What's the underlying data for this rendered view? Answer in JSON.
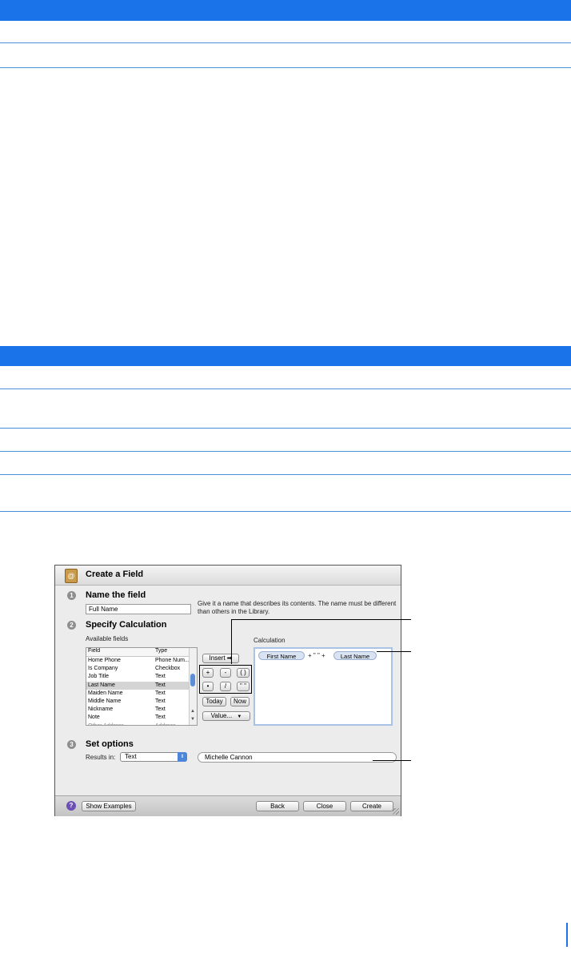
{
  "window": {
    "title": "Create a Field",
    "app_icon": "address-book-icon",
    "steps": {
      "step1": {
        "number": "1",
        "heading": "Name the field"
      },
      "step2": {
        "number": "2",
        "heading": "Specify Calculation"
      },
      "step3": {
        "number": "3",
        "heading": "Set options"
      }
    },
    "name_field_value": "Full Name",
    "name_hint": "Give it a name that describes its contents. The name must be different than others in the Library.",
    "available_fields_label": "Available fields",
    "columns": {
      "field": "Field",
      "type": "Type"
    },
    "rows": [
      {
        "field": "Home Phone",
        "type": "Phone Num..."
      },
      {
        "field": "Is Company",
        "type": "Checkbox"
      },
      {
        "field": "Job Title",
        "type": "Text"
      },
      {
        "field": "Last Name",
        "type": "Text"
      },
      {
        "field": "Maiden Name",
        "type": "Text"
      },
      {
        "field": "Middle Name",
        "type": "Text"
      },
      {
        "field": "Nickname",
        "type": "Text"
      },
      {
        "field": "Note",
        "type": "Text"
      },
      {
        "field": "Other Address",
        "type": "Address"
      }
    ],
    "selected_row": "Last Name",
    "insert_button": "Insert ➡",
    "operators": {
      "plus": "+",
      "minus": "-",
      "parens": "( )",
      "times": "•",
      "divide": "/",
      "quote": "\" \""
    },
    "today_button": "Today",
    "now_button": "Now",
    "value_button": "Value...",
    "calculation_label": "Calculation",
    "calculation": {
      "token1": "First Name",
      "op1": "+ \" \" +",
      "token2": "Last Name"
    },
    "results_label": "Results in:",
    "results_value": "Text",
    "preview_value": "Michelle Cannon",
    "help_icon": "?",
    "show_examples_button": "Show Examples",
    "back_button": "Back",
    "close_button": "Close",
    "create_button": "Create"
  },
  "colors": {
    "accent_blue": "#1a73e8",
    "rule_blue": "#4a90d9",
    "selection": "#d4d4d4"
  }
}
